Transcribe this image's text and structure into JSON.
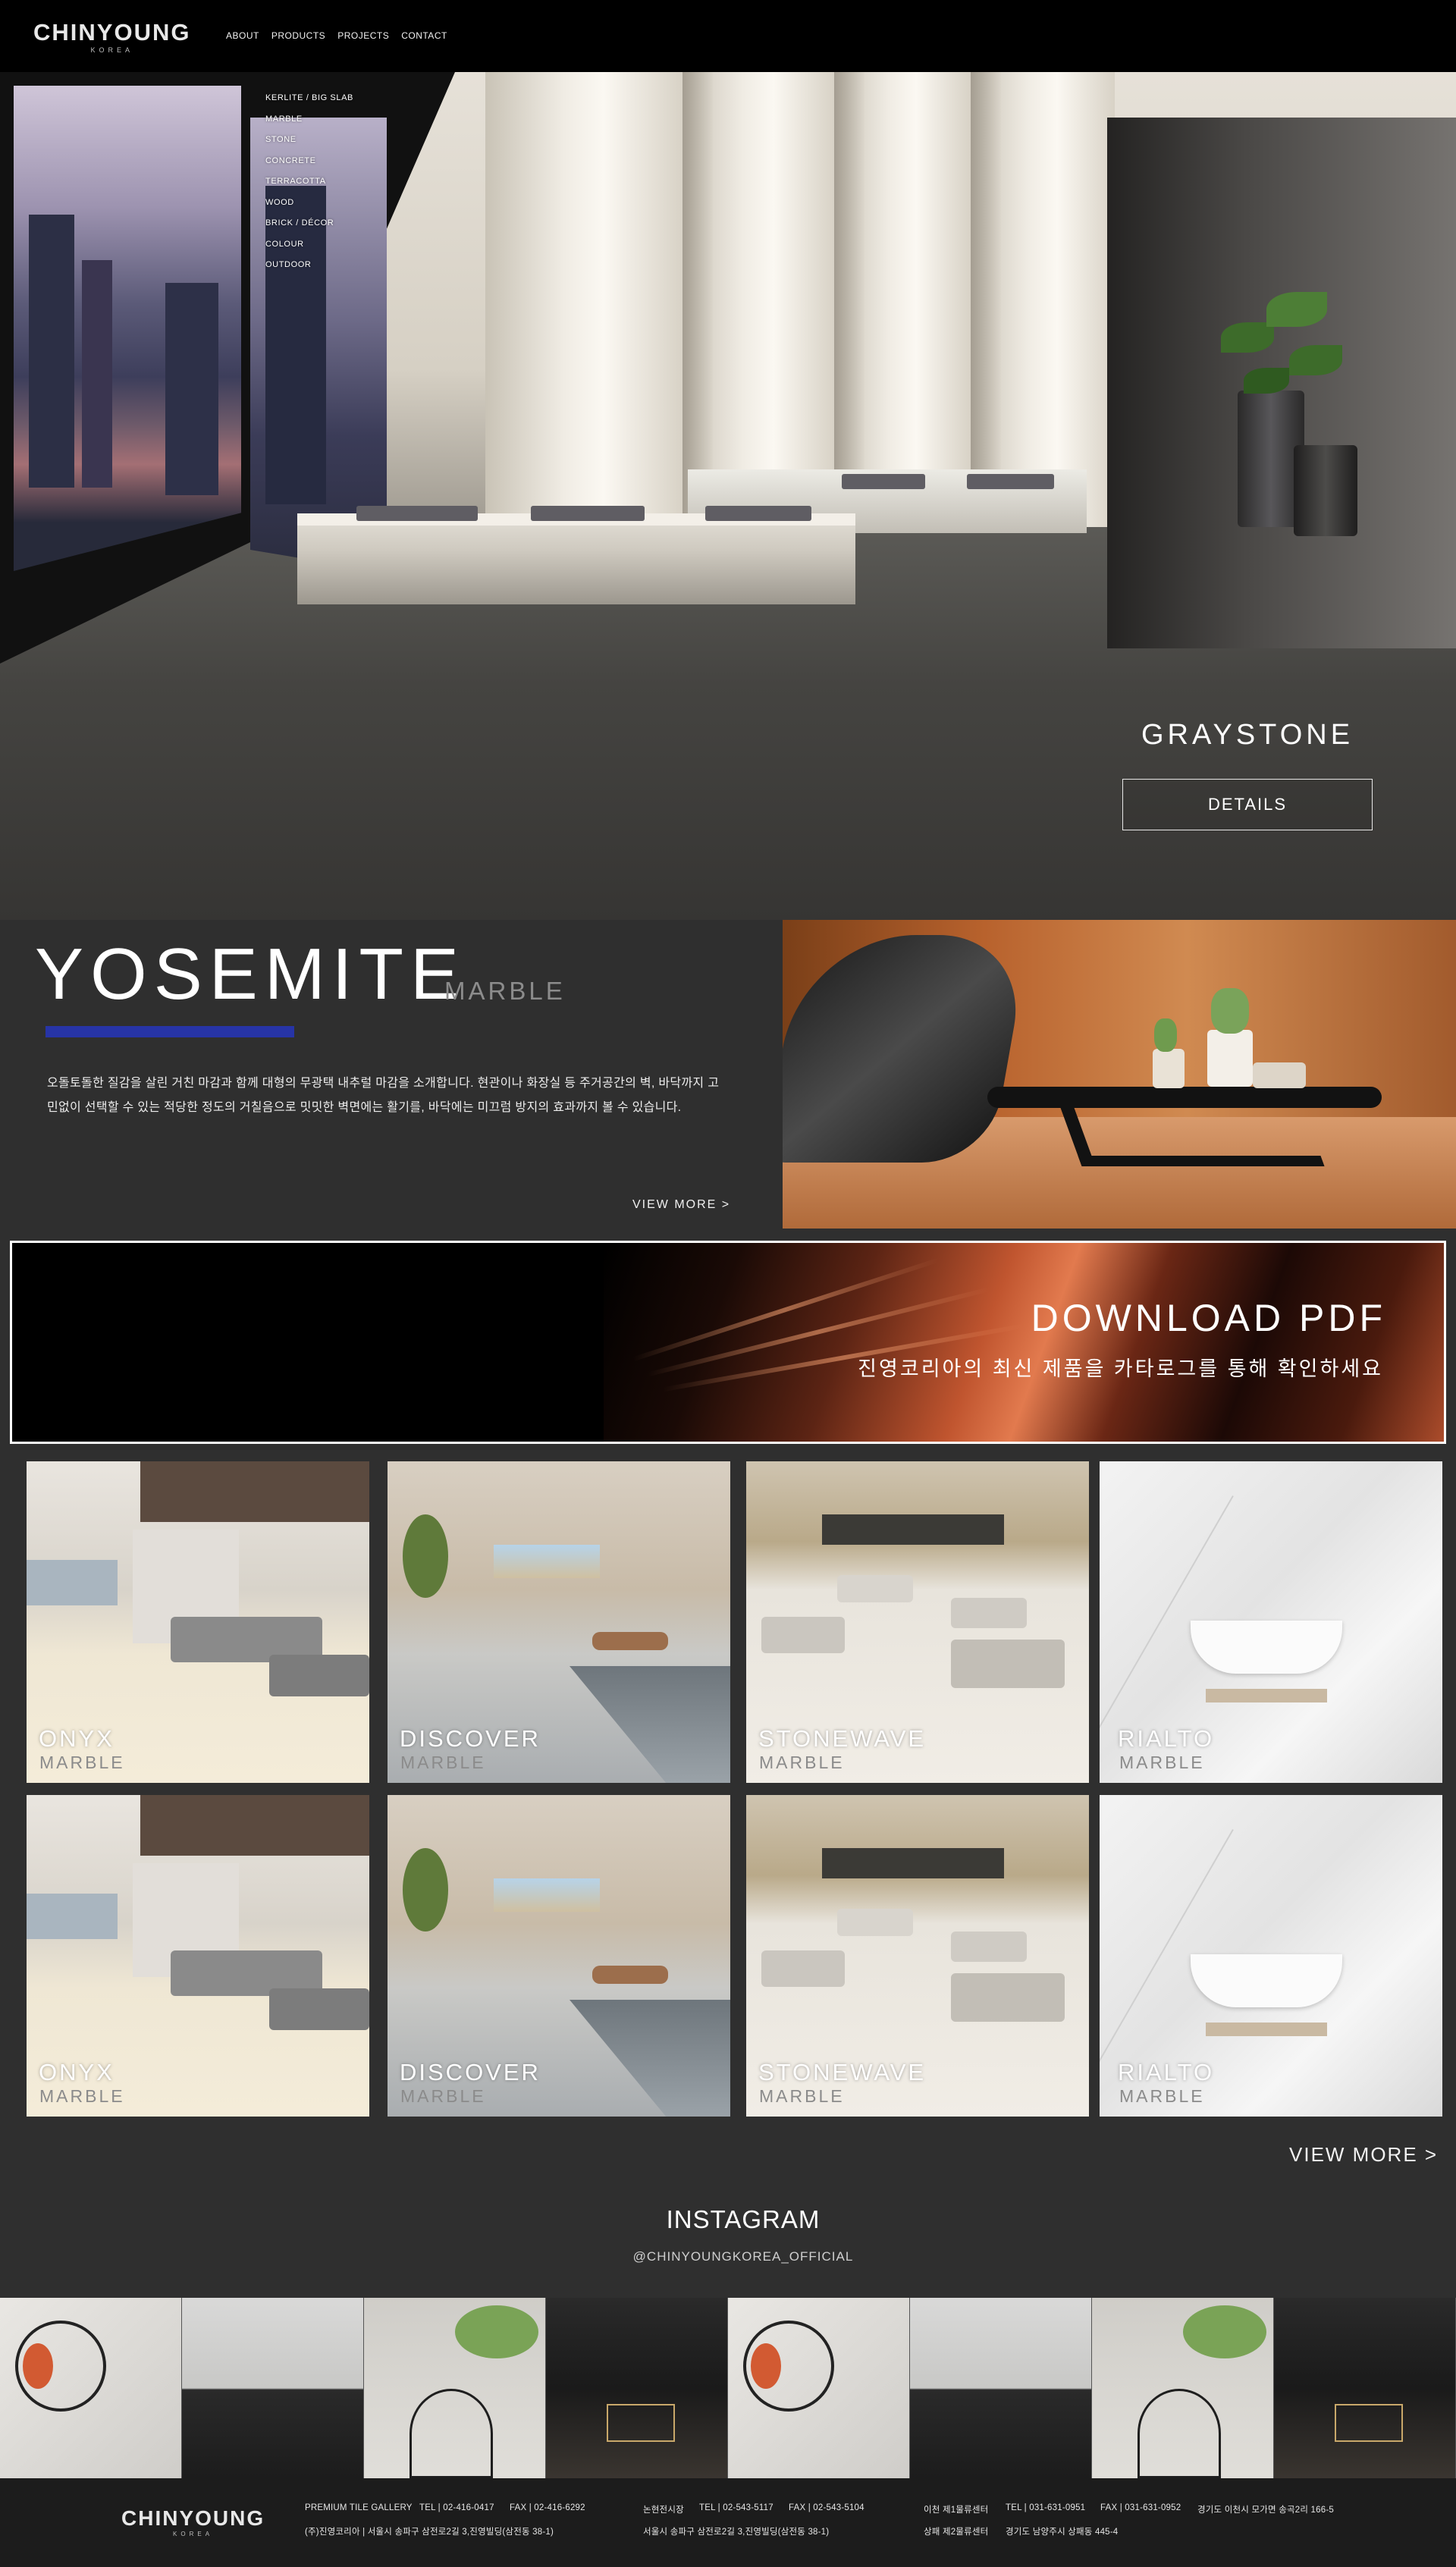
{
  "header": {
    "logo_brand": "CHINYOUNG",
    "logo_sub": "KOREA",
    "nav": [
      "ABOUT",
      "PRODUCTS",
      "PROJECTS",
      "CONTACT"
    ]
  },
  "hero": {
    "submenu": [
      "KERLITE / BIG SLAB",
      "MARBLE",
      "STONE",
      "CONCRETE",
      "TERRACOTTA",
      "WOOD",
      "BRICK / DÉCOR",
      "COLOUR",
      "OUTDOOR"
    ],
    "title": "GRAYSTONE",
    "button": "DETAILS"
  },
  "feature": {
    "title": "YOSEMITE",
    "category": "MARBLE",
    "accent_color": "#2734a6",
    "description": "오돌토돌한 질감을 살린 거친 마감과 함께 대형의 무광택 내추럴 마감을 소개합니다. 현관이나 화장실 등 주거공간의 벽, 바닥까지 고민없이 선택할 수 있는 적당한 정도의 거칠음으로 밋밋한 벽면에는 활기를, 바닥에는 미끄럼 방지의 효과까지 볼 수 있습니다.",
    "view_more": "VIEW MORE >"
  },
  "download": {
    "title": "DOWNLOAD PDF",
    "subtitle": "진영코리아의 최신 제품을 카타로그를 통해 확인하세요"
  },
  "products": {
    "items": [
      {
        "name": "ONYX",
        "category": "MARBLE"
      },
      {
        "name": "DISCOVER",
        "category": "MARBLE"
      },
      {
        "name": "STONEWAVE",
        "category": "MARBLE"
      },
      {
        "name": "RIALTO",
        "category": "MARBLE"
      },
      {
        "name": "ONYX",
        "category": "MARBLE"
      },
      {
        "name": "DISCOVER",
        "category": "MARBLE"
      },
      {
        "name": "STONEWAVE",
        "category": "MARBLE"
      },
      {
        "name": "RIALTO",
        "category": "MARBLE"
      }
    ],
    "view_more": "VIEW MORE >"
  },
  "instagram": {
    "title": "INSTAGRAM",
    "handle": "@CHINYOUNGKOREA_OFFICIAL"
  },
  "footer": {
    "logo_brand": "CHINYOUNG",
    "logo_sub": "KOREA",
    "gallery_name": "PREMIUM TILE GALLERY",
    "gallery_tel": "TEL | 02-416-0417",
    "gallery_fax": "FAX | 02-416-6292",
    "gallery_address": "(주)진영코리아 | 서울시 송파구 삼전로2길 3,진영빌딩(삼전동 38-1)",
    "showroom_name": "논현전시장",
    "showroom_tel": "TEL | 02-543-5117",
    "showroom_fax": "FAX | 02-543-5104",
    "showroom_address": "서울시 송파구 삼전로2길 3,진영빌딩(삼전동 38-1)",
    "logistics1_name": "이천 제1물류센터",
    "logistics1_tel": "TEL | 031-631-0951",
    "logistics1_fax": "FAX | 031-631-0952",
    "logistics1_address": "경기도 이천시 모가면 송곡2리 166-5",
    "logistics2_name": "상패 제2물류센터",
    "logistics2_address": "경기도 남양주시 상패동 445-4"
  }
}
